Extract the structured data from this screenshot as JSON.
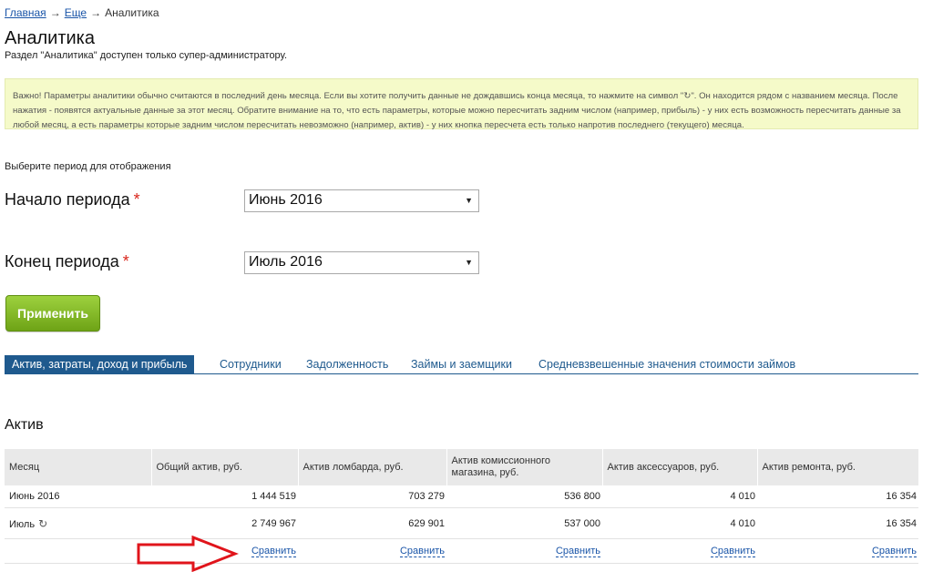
{
  "breadcrumb": {
    "home": "Главная",
    "sep1": "→",
    "more": "Еще",
    "sep2": "→",
    "current": "Аналитика"
  },
  "page": {
    "title": "Аналитика",
    "subtitle": "Раздел \"Аналитика\" доступен только супер-администратору."
  },
  "notice": {
    "text": "Важно! Параметры аналитики обычно считаются в последний день месяца. Если вы хотите получить данные не дождавшись конца месяца, то нажмите на символ \"↻\". Он находится рядом с названием месяца. После нажатия - появятся актуальные данные за этот месяц. Обратите внимание на то, что есть параметры, которые можно пересчитать задним числом (например, прибыль) - у них есть возможность пересчитать данные за любой месяц, а есть параметры которые задним числом пересчитать невозможно (например, актив) - у них кнопка пересчета есть только напротив последнего (текущего) месяца."
  },
  "period": {
    "prompt": "Выберите период для отображения",
    "start_label": "Начало периода",
    "start_value": "Июнь 2016",
    "end_label": "Конец периода",
    "end_value": "Июль 2016",
    "required_mark": "*",
    "apply_label": "Применить"
  },
  "tabs": [
    {
      "label": "Актив, затраты, доход и прибыль",
      "active": true
    },
    {
      "label": "Сотрудники"
    },
    {
      "label": "Задолженность"
    },
    {
      "label": "Займы и заемщики"
    },
    {
      "label": "Средневзвешенные значения стоимости займов"
    }
  ],
  "section": {
    "title": "Актив"
  },
  "table": {
    "headers": [
      "Месяц",
      "Общий актив, руб.",
      "Актив ломбарда, руб.",
      "Актив комиссионного магазина, руб.",
      "Актив аксессуаров, руб.",
      "Актив ремонта, руб."
    ],
    "rows": [
      {
        "month": "Июнь 2016",
        "cells": [
          "1 444 519",
          "703 279",
          "536 800",
          "4 010",
          "16 354"
        ]
      },
      {
        "month": "Июль",
        "refresh": "↻",
        "cells": [
          "2 749 967",
          "629 901",
          "537 000",
          "4 010",
          "16 354"
        ]
      }
    ],
    "compare_label": "Сравнить"
  },
  "colors": {
    "accent": "#1f5a8e",
    "apply_button": "#7fb622",
    "notice_bg": "#f5fac9",
    "annotation_arrow": "#e0141b"
  }
}
